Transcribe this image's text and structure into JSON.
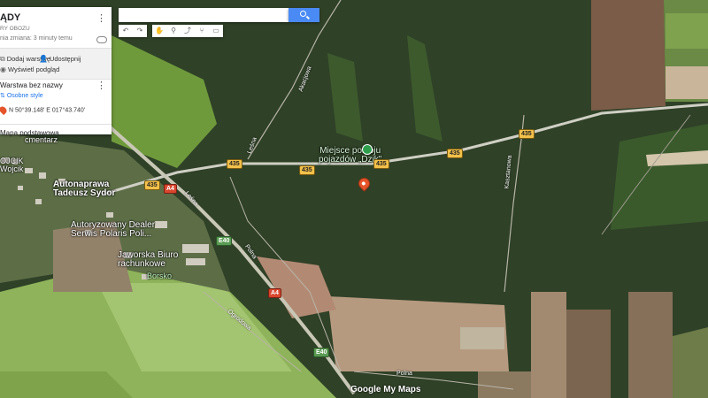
{
  "panel": {
    "title": "ĄDY",
    "subtitle": "RY OBOZU",
    "last_edit": "nia zmiana: 3 minuty temu",
    "add_layer": "Dodaj warstwę",
    "share": "Udostępnij",
    "preview": "Wyświetl podgląd",
    "layer_name": "Warstwa bez nazwy",
    "custom_style": "Osobne style",
    "coord": "N 50°39.148' E 017°43.740'",
    "basemap": "Mapa podstawowa"
  },
  "search": {
    "placeholder": ""
  },
  "map_labels": {
    "poi": "Miejsce postoju\npojazdów „Dzik\"",
    "cmentarz": "cmentarz",
    "ojcik": "OJCIK\nWojcik",
    "autonaprawa": "Autonaprawa\nTadeusz Sydor",
    "dealer": "Autoryzowany Dealer\nSerwis Polaris Poli...",
    "biuro": "Jaworska Biuro\nrachunkowe",
    "borsko": "Borsko",
    "logo": "Google My Maps"
  },
  "shields": {
    "r435a": "435",
    "r435b": "435",
    "r435c": "435",
    "r435d": "435",
    "r435e": "435",
    "r435f": "435",
    "a4a": "A4",
    "a4b": "A4",
    "e40a": "E40",
    "e40b": "E40"
  },
  "streets": {
    "akacjowa": "Akacjowa",
    "lesna": "Leśna",
    "kasztanowa": "Kasztanowa",
    "lesna2": "Leśna",
    "polna": "Polna",
    "ogrodowa": "Ogrodowa",
    "polna2": "Polna"
  },
  "colors": {
    "accent": "#4a8af4",
    "pin": "#e6542a",
    "poi": "#2e9e4d"
  }
}
